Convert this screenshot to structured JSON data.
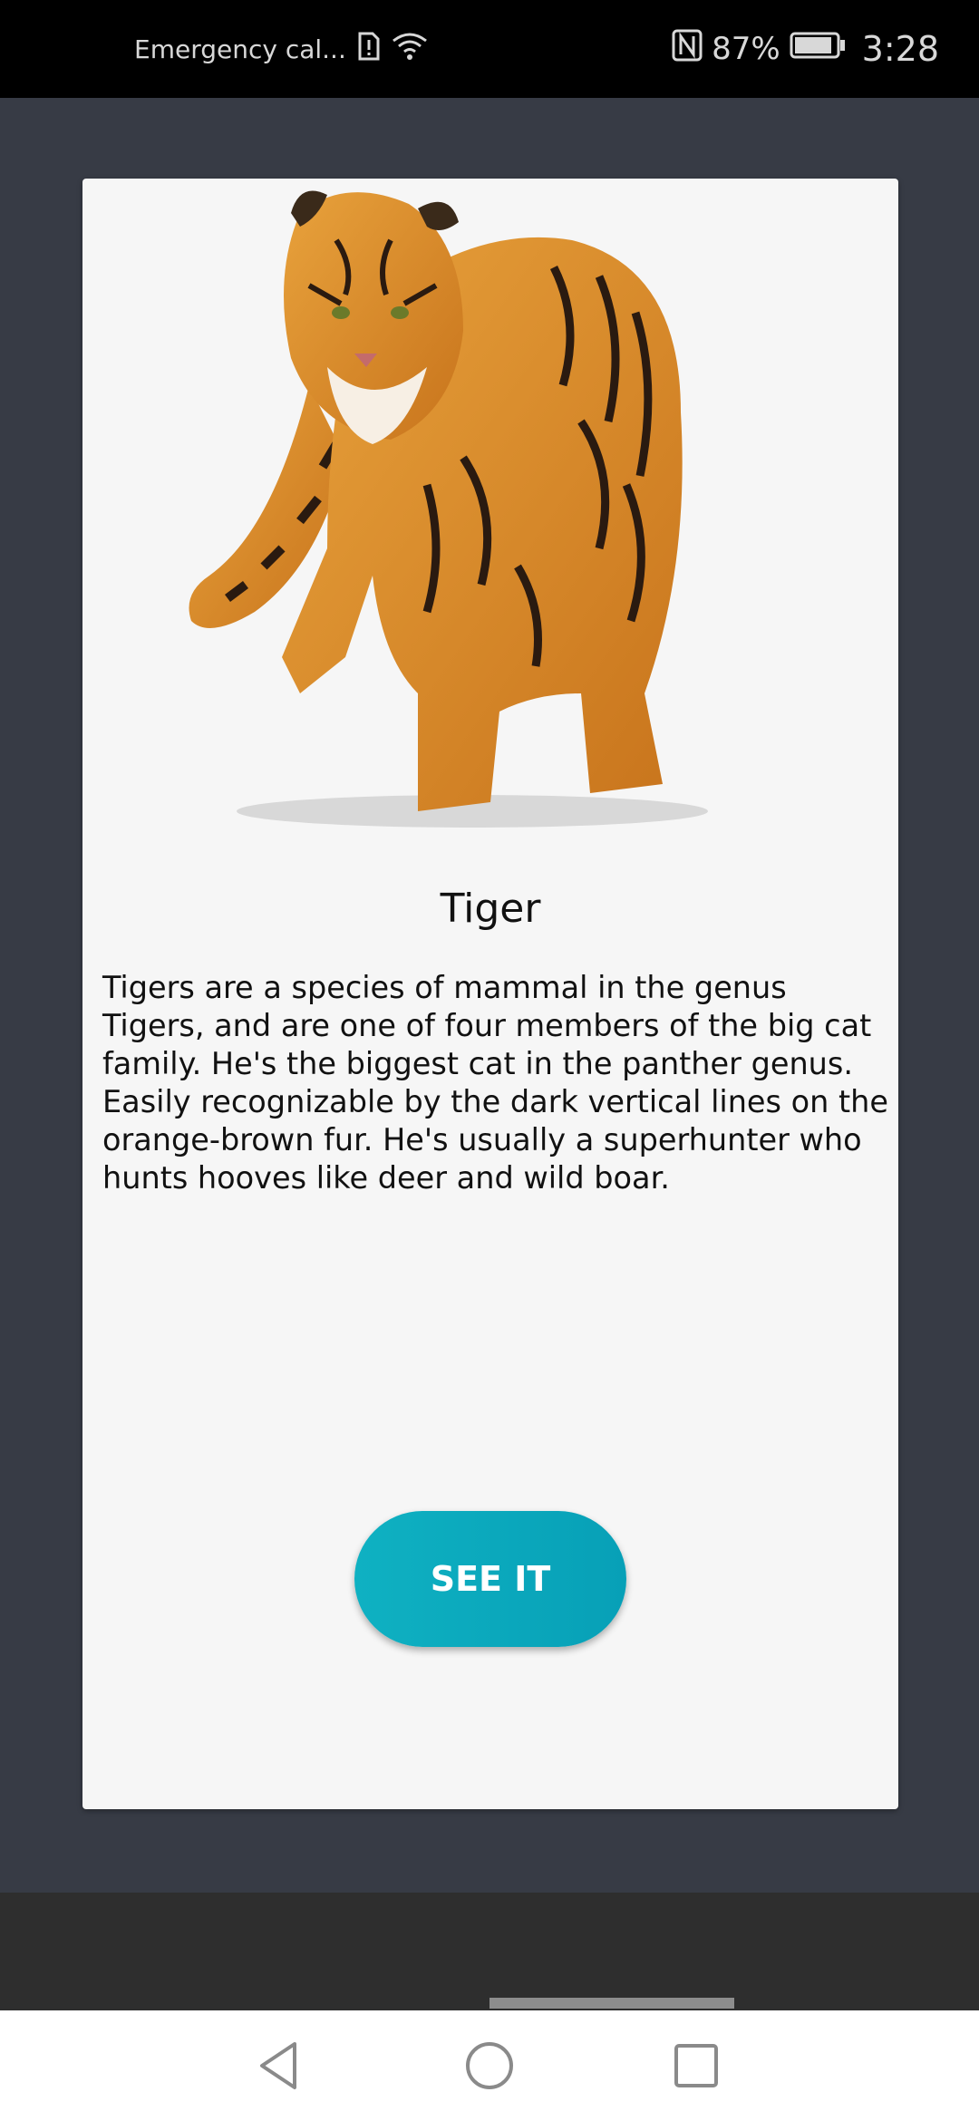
{
  "status_bar": {
    "carrier": "Emergency cal...",
    "battery": "87%",
    "time": "3:28",
    "icons": [
      "sim-alert-icon",
      "wifi-icon",
      "nfc-icon",
      "battery-icon"
    ]
  },
  "card": {
    "image_icon": "tiger-image",
    "title": "Tiger",
    "description": "Tigers are a species of mammal in the genus Tigers, and are one of four members of the big cat family. He's the biggest cat in the panther genus. Easily recognizable by the dark vertical lines on the orange-brown fur. He's usually a superhunter who hunts hooves like deer and wild boar.",
    "button_label": "SEE IT"
  },
  "colors": {
    "background": "#373b45",
    "card": "#f6f6f6",
    "button": "#0aa8bc",
    "status_bar": "#000000"
  },
  "nav_bar": {
    "icons": [
      "back-icon",
      "home-icon",
      "recents-icon"
    ]
  }
}
